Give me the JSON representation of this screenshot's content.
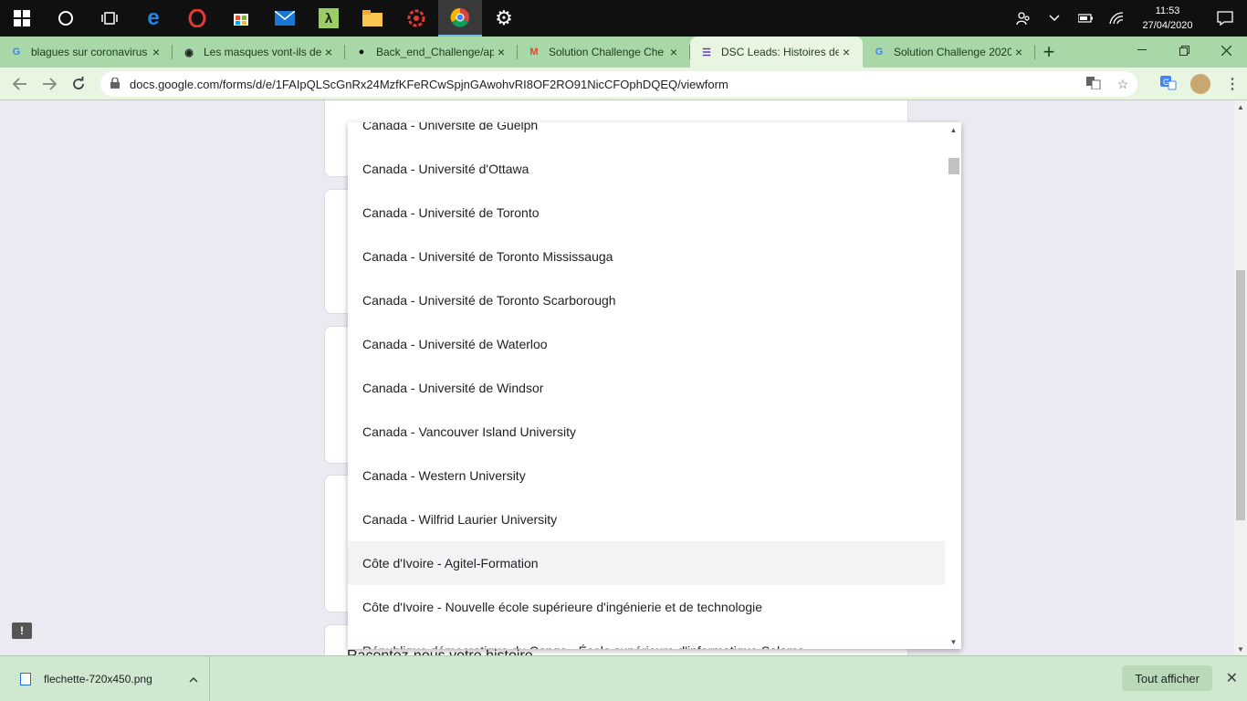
{
  "taskbar": {
    "icons": [
      "windows-start-icon",
      "cortana-icon",
      "task-view-icon",
      "edge-icon",
      "opera-icon",
      "store-icon",
      "mail-icon",
      "lambda-icon",
      "file-explorer-icon",
      "gear-logo-icon",
      "chrome-icon",
      "settings-icon"
    ],
    "clock_time": "11:53",
    "clock_date": "27/04/2020"
  },
  "tabs": [
    {
      "title": "blagues sur coronavirus",
      "favicon": "G",
      "favicon_color": "#4285f4",
      "active": false
    },
    {
      "title": "Les masques vont-ils de",
      "favicon": "◉",
      "favicon_color": "#222222",
      "active": false
    },
    {
      "title": "Back_end_Challenge/ap",
      "favicon": "●",
      "favicon_color": "#111111",
      "active": false
    },
    {
      "title": "Solution Challenge Che",
      "favicon": "M",
      "favicon_color": "#ea4335",
      "active": false
    },
    {
      "title": "DSC Leads: Histoires de",
      "favicon": "☰",
      "favicon_color": "#673ab7",
      "active": true
    },
    {
      "title": "Solution Challenge 2020",
      "favicon": "G",
      "favicon_color": "#4285f4",
      "active": false
    }
  ],
  "toolbar": {
    "url": "docs.google.com/forms/d/e/1FAIpQLScGnRx24MzfKFeRCwSpjnGAwohvRI8OF2RO91NicCFOphDQEQ/viewform"
  },
  "page": {
    "peek_text": "Racontez-nous votre histoire"
  },
  "dropdown": {
    "items": [
      "Canada - Université de Guelph",
      "Canada - Université d'Ottawa",
      "Canada - Université de Toronto",
      "Canada - Université de Toronto Mississauga",
      "Canada - Université de Toronto Scarborough",
      "Canada - Université de Waterloo",
      "Canada - Université de Windsor",
      "Canada - Vancouver Island University",
      "Canada - Western University",
      "Canada - Wilfrid Laurier University",
      "Côte d'Ivoire - Agitel-Formation",
      "Côte d'Ivoire - Nouvelle école supérieure d'ingénierie et de technologie",
      "République démocratique du Congo - École supérieure d'informatique Salama"
    ],
    "hovered_index": 10
  },
  "downloads": {
    "file_name": "flechette-720x450.png",
    "show_all_label": "Tout afficher"
  }
}
